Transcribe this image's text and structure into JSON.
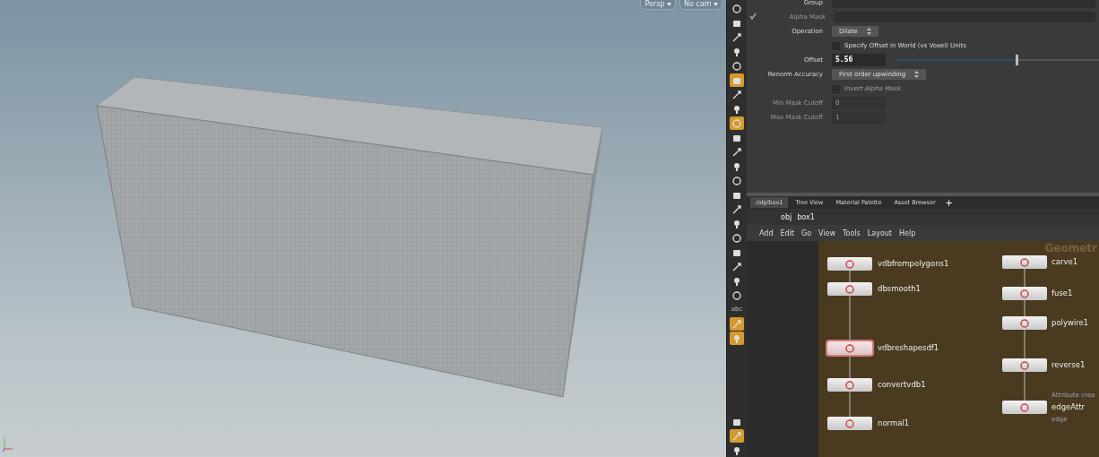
{
  "viewport": {
    "camera_menus": [
      {
        "label": "Persp"
      },
      {
        "label": "No cam"
      }
    ]
  },
  "shelf": [
    {
      "selected": false
    },
    {
      "selected": false
    },
    {
      "selected": false
    },
    {
      "selected": false
    },
    {
      "selected": false
    },
    {
      "selected": true
    },
    {
      "selected": false
    },
    {
      "selected": false
    },
    {
      "selected": true
    },
    {
      "selected": false
    },
    {
      "selected": false
    },
    {
      "selected": false
    },
    {
      "selected": false
    },
    {
      "selected": false
    },
    {
      "selected": false
    },
    {
      "selected": false
    },
    {
      "selected": false
    },
    {
      "selected": false
    },
    {
      "selected": false
    },
    {
      "selected": false
    },
    {
      "selected": false
    },
    {
      "selected": false,
      "label": "abc"
    },
    {
      "selected": true
    },
    {
      "selected": true
    }
  ],
  "shelf_bottom": [
    {
      "selected": false
    },
    {
      "selected": true
    },
    {
      "selected": false
    }
  ],
  "params": [
    {
      "kind": "field",
      "label": "Group",
      "disabled": false
    },
    {
      "kind": "field",
      "label": "Alpha Mask",
      "checked": true,
      "disabled": true
    },
    {
      "kind": "menu",
      "label": "Operation",
      "value": "Dilate"
    },
    {
      "kind": "toggle",
      "label": "Specify Offset in World (vs Voxel) Units",
      "checked": false,
      "disabled": false
    },
    {
      "kind": "slider",
      "label": "Offset",
      "value": "5.56",
      "level": 0.59
    },
    {
      "kind": "menu",
      "label": "Renorm Accuracy",
      "value": "First order upwinding"
    },
    {
      "kind": "toggle",
      "label": "Invert Alpha Mask",
      "checked": false,
      "disabled": true
    },
    {
      "kind": "number",
      "label": "Min Mask Cutoff",
      "value": "0",
      "disabled": true
    },
    {
      "kind": "number",
      "label": "Max Mask Cutoff",
      "value": "1",
      "disabled": true
    }
  ],
  "tabs": [
    {
      "label": "/obj/box1",
      "selected": true
    },
    {
      "label": "Tree View",
      "selected": false
    },
    {
      "label": "Material Palette",
      "selected": false
    },
    {
      "label": "Asset Browser",
      "selected": false
    }
  ],
  "add_tab": "+",
  "path": [
    "obj",
    "box1"
  ],
  "menu": [
    "Add",
    "Edit",
    "Go",
    "View",
    "Tools",
    "Layout",
    "Help"
  ],
  "network": {
    "context_label": "Geometr",
    "columns": [
      [
        {
          "name": "vdbfrompolygons1",
          "selected": false
        },
        {
          "name": "dbsmooth1",
          "selected": false
        },
        {
          "name": "vdbreshapesdf1",
          "selected": true
        },
        {
          "name": "convertvdb1",
          "selected": false
        },
        {
          "name": "normal1",
          "selected": false
        }
      ],
      [
        {
          "name": "carve1",
          "selected": false
        },
        {
          "name": "fuse1",
          "selected": false
        },
        {
          "name": "polywire1",
          "selected": false
        },
        {
          "name": "reverse1",
          "selected": false
        },
        {
          "name": "edgeAttr",
          "selected": false,
          "type_label": "Attribute crea",
          "comment": "edge"
        }
      ]
    ]
  }
}
